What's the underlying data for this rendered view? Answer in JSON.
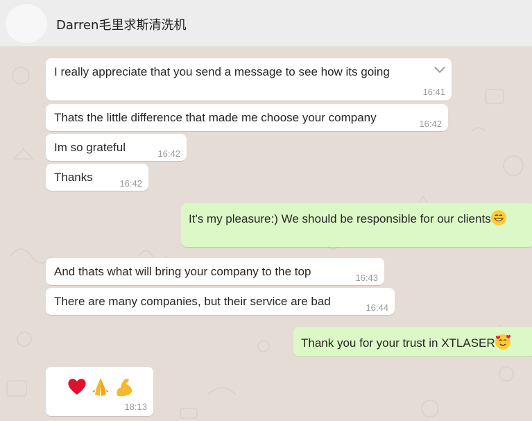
{
  "header": {
    "contact_name": "Darren毛里求斯清洗机"
  },
  "messages": [
    {
      "direction": "in",
      "text": "I really appreciate that you send a message to see how its going",
      "time": "16:41"
    },
    {
      "direction": "in",
      "text": "Thats the little difference that made me choose your company",
      "time": "16:42"
    },
    {
      "direction": "in",
      "text": "Im so grateful",
      "time": "16:42"
    },
    {
      "direction": "in",
      "text": "Thanks",
      "time": "16:42"
    },
    {
      "direction": "out",
      "text": "It's my pleasure:) We should be responsible for our clients",
      "emoji": "grinning-face-icon"
    },
    {
      "direction": "in",
      "text": "And thats what will bring your company to the top",
      "time": "16:43"
    },
    {
      "direction": "in",
      "text": "There are many companies, but their service are bad",
      "time": "16:44"
    },
    {
      "direction": "out",
      "text": "Thank you for your trust in XTLASER",
      "emoji": "smiling-face-with-hearts-icon"
    },
    {
      "direction": "in",
      "emojis": [
        "red-heart-icon",
        "folded-hands-icon",
        "flexed-biceps-icon"
      ],
      "time": "18:13"
    }
  ],
  "colors": {
    "incoming_bubble": "#ffffff",
    "outgoing_bubble": "#dcf8c6",
    "chat_background": "#e5ddd5",
    "header_background": "#ededed"
  }
}
